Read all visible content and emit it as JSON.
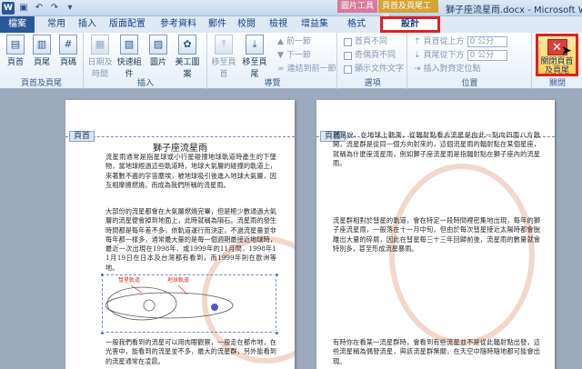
{
  "window": {
    "title": "獅子座流星雨.docx - Microsoft W...",
    "context_tab_picture": "圖片工具",
    "context_tab_header_footer": "頁首及頁尾工具"
  },
  "tabs": {
    "file": "檔案",
    "home": "常用",
    "insert": "插入",
    "layout": "版面配置",
    "references": "參考資料",
    "mailings": "郵件",
    "review": "校閱",
    "view": "檢視",
    "addins": "增益集",
    "format": "格式",
    "design": "設計"
  },
  "ribbon": {
    "hf_group": {
      "label": "頁首及頁尾",
      "header": "頁首",
      "footer": "頁尾",
      "page_number": "頁碼"
    },
    "insert_group": {
      "label": "插入",
      "datetime": "日期及時間",
      "quick_parts": "快速組件",
      "picture": "圖片",
      "clip_art": "美工圖案"
    },
    "nav_group": {
      "label": "導覽",
      "goto_header": "移至頁首",
      "goto_footer": "移至頁尾",
      "previous": "前一節",
      "next": "下一節",
      "link_previous": "連結到前一節"
    },
    "options_group": {
      "label": "選項",
      "first_page": "首頁不同",
      "odd_even": "奇偶頁不同",
      "show_doc_text": "顯示文件文字"
    },
    "position_group": {
      "label": "位置",
      "header_from_top": "頁首從上方",
      "footer_from_bottom": "頁尾從下方",
      "insert_align_tab": "插入對齊定位點",
      "header_value": "0 公分",
      "footer_value": "0 公分"
    },
    "close_group": {
      "label": "關閉",
      "close_button": "關閉頁首及頁尾"
    }
  },
  "document": {
    "header_label_1": "頁首",
    "header_label_2": "頁首",
    "title": "獅子座流星雨",
    "page1_para1": "流星雨通常是指星球或小行星碰撞地球軌道時產生的下墜物，當地球經過這些軌道時，地球大氣層的碰撞的軌道上，來著數不盡的宇宙塵埃，被地球吸引後進入地球大氣層，因互相摩擦燃燒，而成為我們所稱的流星雨。",
    "page1_para2": "大部份的流星都會在大氣層燃燒完畢，但是極少數通過大氣層的流星便會掉到地面上，此時就稱為隕石。流星雨的發生時間都是每年差不多，依軌道運行而決定，不過流星量並非每年都一樣多，通常最大量的是每一個週期最接近地球時，最近一次出現在1998年、或1999年的11月間，1998年11月19日在日本及台灣都有看到，而1999年則在歐洲等地。",
    "orbit_label_a": "彗星軌道",
    "orbit_label_b": "地球軌道",
    "page1_para3": "一般我們看到的流星可以用肉眼觀察，一般走在都市地，在光害中，能看到的流星並不多，最大的流星群，另外能看到的流星通常在凌晨。",
    "page2_para1": "就是說，在地球上觀測，從輻射點看去流星是由此一點向四面八方散開，流星群是從同一個方向射來的，這個流星雨的輻射點在某個星座，就稱為什麼座流星雨，例如獅子座流星雨是指輻射點在獅子座內的流星雨。",
    "page2_para2": "流星群相對於彗星的軌道，會在特定一段時間裡密集地出現，每年的獅子座流星雨，一般落在十一月中旬，但由於每次彗星接近太陽時都會脫離出大量的碎屑，因此在彗星每三十三年回歸前後，流星雨的數量就會特別多，甚至形成流星暴雨。",
    "page2_para3": "有時你在看某一流星群時，會看到有些流星並不是從此輻射點出發，這些流星稱為偶發流星，與該流星群無關，在天空中隨時隨地都可能會出現。"
  },
  "colors": {
    "accent": "#2b5797",
    "highlight_border": "#e02020",
    "ribbon_bg": "#e6eef8",
    "doc_bg": "#9daabd"
  }
}
